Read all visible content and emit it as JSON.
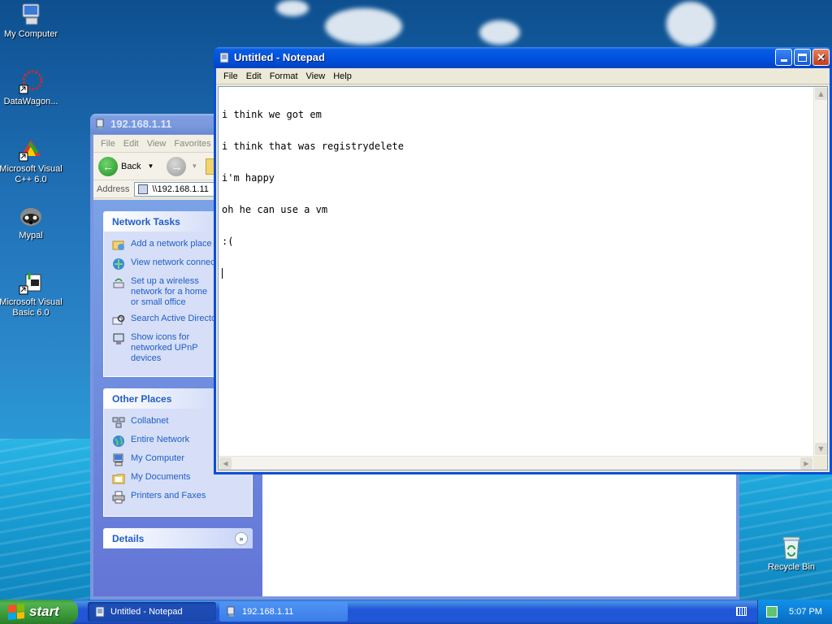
{
  "desktop": {
    "icons": [
      {
        "label": "My Computer",
        "icon": "my-computer-icon"
      },
      {
        "label": "DataWagon...",
        "icon": "datawagon-icon"
      },
      {
        "label": "Microsoft Visual C++ 6.0",
        "icon": "visual-cpp-icon"
      },
      {
        "label": "Mypal",
        "icon": "mypal-icon"
      },
      {
        "label": "Microsoft Visual Basic 6.0",
        "icon": "visual-basic-icon"
      },
      {
        "label": "Recycle Bin",
        "icon": "recycle-bin-icon"
      }
    ]
  },
  "explorer": {
    "title": "192.168.1.11",
    "menu": [
      "File",
      "Edit",
      "View",
      "Favorites"
    ],
    "back_label": "Back",
    "address_label": "Address",
    "address_value": "\\\\192.168.1.11",
    "network_tasks": {
      "title": "Network Tasks",
      "items": [
        "Add a network place",
        "View network connections",
        "Set up a wireless network for a home or small office",
        "Search Active Directory",
        "Show icons for networked UPnP devices"
      ]
    },
    "other_places": {
      "title": "Other Places",
      "items": [
        "Collabnet",
        "Entire Network",
        "My Computer",
        "My Documents",
        "Printers and Faxes"
      ]
    },
    "details": {
      "title": "Details"
    }
  },
  "notepad": {
    "title": "Untitled - Notepad",
    "menu": [
      "File",
      "Edit",
      "Format",
      "View",
      "Help"
    ],
    "lines": [
      "i think we got em",
      "i think that was registrydelete",
      "i'm happy",
      "oh he can use a vm",
      ":("
    ]
  },
  "taskbar": {
    "start_label": "start",
    "tasks": [
      {
        "label": "Untitled - Notepad",
        "active": true
      },
      {
        "label": "192.168.1.11",
        "active": false
      }
    ],
    "clock": "5:07 PM"
  },
  "colors": {
    "xp_blue": "#0053e1",
    "start_green": "#3b9a3b",
    "task_link": "#215dc6"
  }
}
